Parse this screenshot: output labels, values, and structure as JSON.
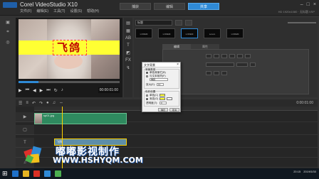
{
  "app": {
    "title": "Corel VideoStudio X10",
    "file_info": "HD 1920x1080 · 无标题.VSP",
    "menu": [
      "文件(F)",
      "编辑(E)",
      "工具(T)",
      "设置(S)",
      "帮助(H)"
    ],
    "steps": [
      "捕获",
      "编辑",
      "共享"
    ],
    "active_step": "编辑",
    "window_controls": [
      "–",
      "□",
      "×"
    ]
  },
  "preview": {
    "caption": "飞鸽",
    "timecode": "00:00:01:00",
    "progress": 0.2
  },
  "library": {
    "gallery_select": "标题",
    "thumbnails": [
      "LOREM",
      "LOREM",
      "LOREM",
      "Lorem",
      "LOREM"
    ],
    "options_tabs": [
      "编辑",
      "属性"
    ]
  },
  "dialog": {
    "title": "文字背景",
    "close": "×",
    "section_type": "背景类型",
    "opt_single": "单色背景栏(B)",
    "opt_fit": "与文本相符(F)",
    "fit_shape": "椭圆",
    "enlarge_label": "放大(E):",
    "enlarge_value": "10",
    "section_color": "色彩设置",
    "solid_label": "单色(C)",
    "gradient_label": "渐变(G)",
    "transparency_label": "透明度(T):",
    "transparency_value": "0",
    "ok": "确定",
    "cancel": "取消",
    "swatches": [
      "#ffff33",
      "#ffffff"
    ]
  },
  "timeline": {
    "timecode": "0:00:01:00",
    "video_clip": "sp01.jpg",
    "title_clip": "飞鸽"
  },
  "watermark": {
    "name": "嘟嘟影视制作",
    "url": "WWW.HSHYQM.COM"
  },
  "taskbar": {
    "start": "⊞",
    "time": "20:15",
    "date": "2019/5/30"
  }
}
